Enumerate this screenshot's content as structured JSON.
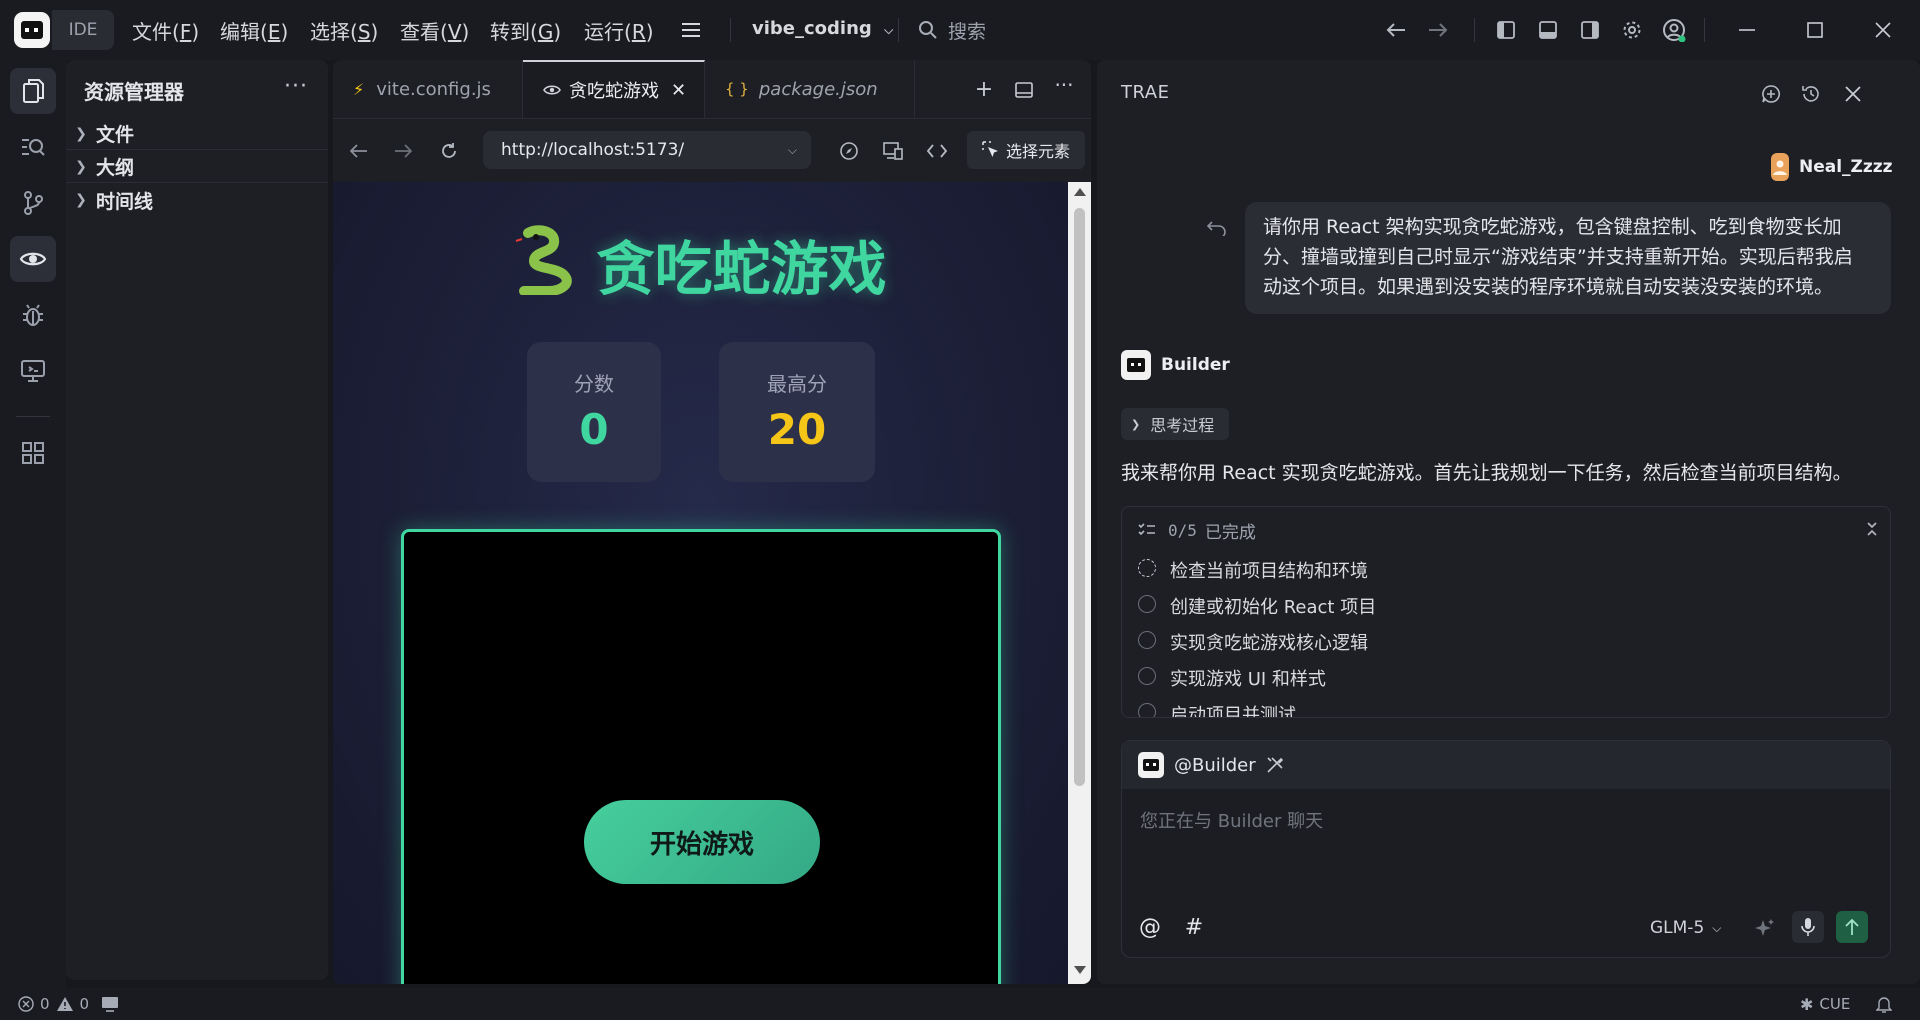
{
  "titlebar": {
    "ide_label": "IDE",
    "menus": [
      "文件(F)",
      "编辑(E)",
      "选择(S)",
      "查看(V)",
      "转到(G)",
      "运行(R)"
    ],
    "menu_keys": [
      "F",
      "E",
      "S",
      "V",
      "G",
      "R"
    ],
    "project": "vibe_coding",
    "search_placeholder": "搜索"
  },
  "explorer": {
    "title": "资源管理器",
    "sections": [
      "文件",
      "大纲",
      "时间线"
    ]
  },
  "editor": {
    "tabs": [
      {
        "label": "vite.config.js",
        "active": false
      },
      {
        "label": "贪吃蛇游戏",
        "active": true
      },
      {
        "label": "package.json",
        "active": false
      }
    ],
    "url": "http://localhost:5173/",
    "pick_element": "选择元素"
  },
  "game": {
    "title": "贪吃蛇游戏",
    "score_label": "分数",
    "score": "0",
    "high_label": "最高分",
    "high_score": "20",
    "start_button": "开始游戏",
    "colors": {
      "accent": "#3fd6a0",
      "score": "#3fd6a0",
      "high": "#f5c518"
    }
  },
  "chat": {
    "title": "TRAE",
    "user": "Neal_Zzzz",
    "message_lines": [
      "请你用 React 架构实现贪吃蛇游戏，包含键盘控制、吃到食物变长加",
      "分、撞墙或撞到自己时显示“游戏结束”并支持重新开始。实现后帮我启",
      "动这个项目。如果遇到没安装的程序环境就自动安装没安装的环境。"
    ],
    "agent": "Builder",
    "thinking": "思考过程",
    "reply": "我来帮你用 React 实现贪吃蛇游戏。首先让我规划一下任务，然后检查当前项目结构。",
    "todo_progress": "0/5",
    "todo_done_label": "已完成",
    "todos": [
      "检查当前项目结构和环境",
      "创建或初始化 React 项目",
      "实现贪吃蛇游戏核心逻辑",
      "实现游戏 UI 和样式",
      "启动项目并测试"
    ],
    "mention": "@Builder",
    "input_placeholder": "您正在与 Builder 聊天",
    "model": "GLM-5"
  },
  "status": {
    "errors": "0",
    "warnings": "0",
    "lang": "CUE"
  }
}
